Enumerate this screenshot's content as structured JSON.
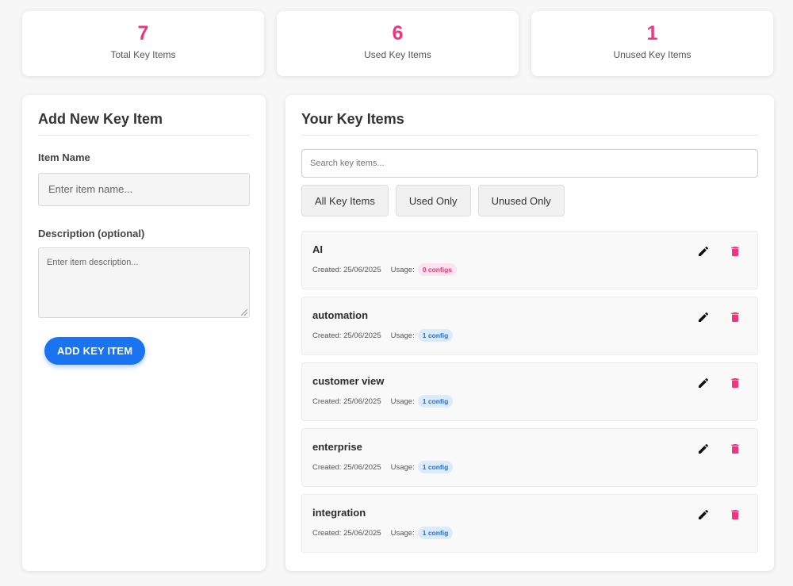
{
  "colors": {
    "accent_pink": "#f0347e",
    "primary_blue": "#1a73f0"
  },
  "stats": [
    {
      "value": "7",
      "label": "Total Key Items"
    },
    {
      "value": "6",
      "label": "Used Key Items"
    },
    {
      "value": "1",
      "label": "Unused Key Items"
    }
  ],
  "add_form": {
    "title": "Add New Key Item",
    "name_label": "Item Name",
    "name_placeholder": "Enter item name...",
    "description_label": "Description (optional)",
    "description_placeholder": "Enter item description...",
    "submit_label": "ADD KEY ITEM"
  },
  "list": {
    "title": "Your Key Items",
    "search_placeholder": "Search key items...",
    "filters": [
      "All Key Items",
      "Used Only",
      "Unused Only"
    ],
    "created_prefix": "Created:",
    "usage_prefix": "Usage:",
    "items": [
      {
        "name": "AI",
        "created": "25/06/2025",
        "usage": "0 configs"
      },
      {
        "name": "automation",
        "created": "25/06/2025",
        "usage": "1 config"
      },
      {
        "name": "customer view",
        "created": "25/06/2025",
        "usage": "1 config"
      },
      {
        "name": "enterprise",
        "created": "25/06/2025",
        "usage": "1 config"
      },
      {
        "name": "integration",
        "created": "25/06/2025",
        "usage": "1 config"
      }
    ],
    "icons": {
      "edit": "pencil-icon",
      "delete": "trash-icon"
    }
  }
}
